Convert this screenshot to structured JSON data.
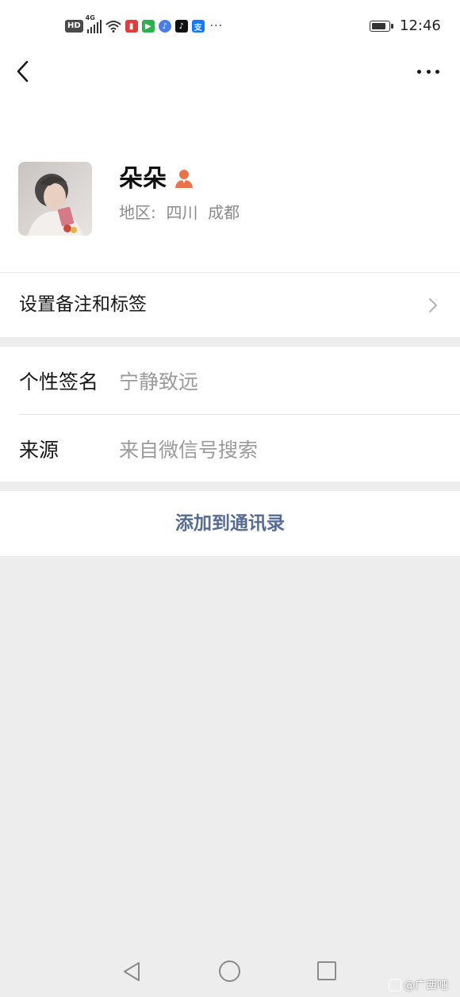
{
  "status_bar": {
    "hd_label": "HD",
    "network": "4G",
    "time": "12:46",
    "more": "···",
    "battery_level": 0.85
  },
  "profile": {
    "nickname": "朵朵",
    "region": "地区:  四川  成都"
  },
  "rows": {
    "remark_label": "设置备注和标签",
    "signature_label": "个性签名",
    "signature_value": "宁静致远",
    "source_label": "来源",
    "source_value": "来自微信号搜索"
  },
  "actions": {
    "add_contact": "添加到通讯录"
  },
  "watermark": {
    "text": "@广西吧"
  },
  "colors": {
    "link_blue": "#576b95",
    "background_gray": "#ededed",
    "person_icon": "#e8734a"
  }
}
